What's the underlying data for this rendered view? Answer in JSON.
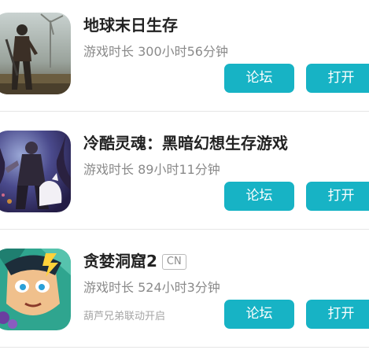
{
  "games": [
    {
      "title": "地球末日生存",
      "play_time": "游戏时长 300小时56分钟",
      "forum_label": "论坛",
      "open_label": "打开",
      "icon": "survivor-artwork-icon"
    },
    {
      "title": "冷酷灵魂：黑暗幻想生存游戏",
      "play_time": "游戏时长 89小时11分钟",
      "forum_label": "论坛",
      "open_label": "打开",
      "icon": "dark-knight-wolf-artwork-icon"
    },
    {
      "title": "贪婪洞窟2",
      "region_tag": "CN",
      "play_time": "游戏时长 524小时3分钟",
      "promo": "葫芦兄弟联动开启",
      "forum_label": "论坛",
      "open_label": "打开",
      "icon": "cave-hero-artwork-icon"
    }
  ],
  "colors": {
    "accent": "#17b3c5",
    "title": "#222222",
    "subtext": "#8a8a8a",
    "divider": "#e6e6e6"
  }
}
